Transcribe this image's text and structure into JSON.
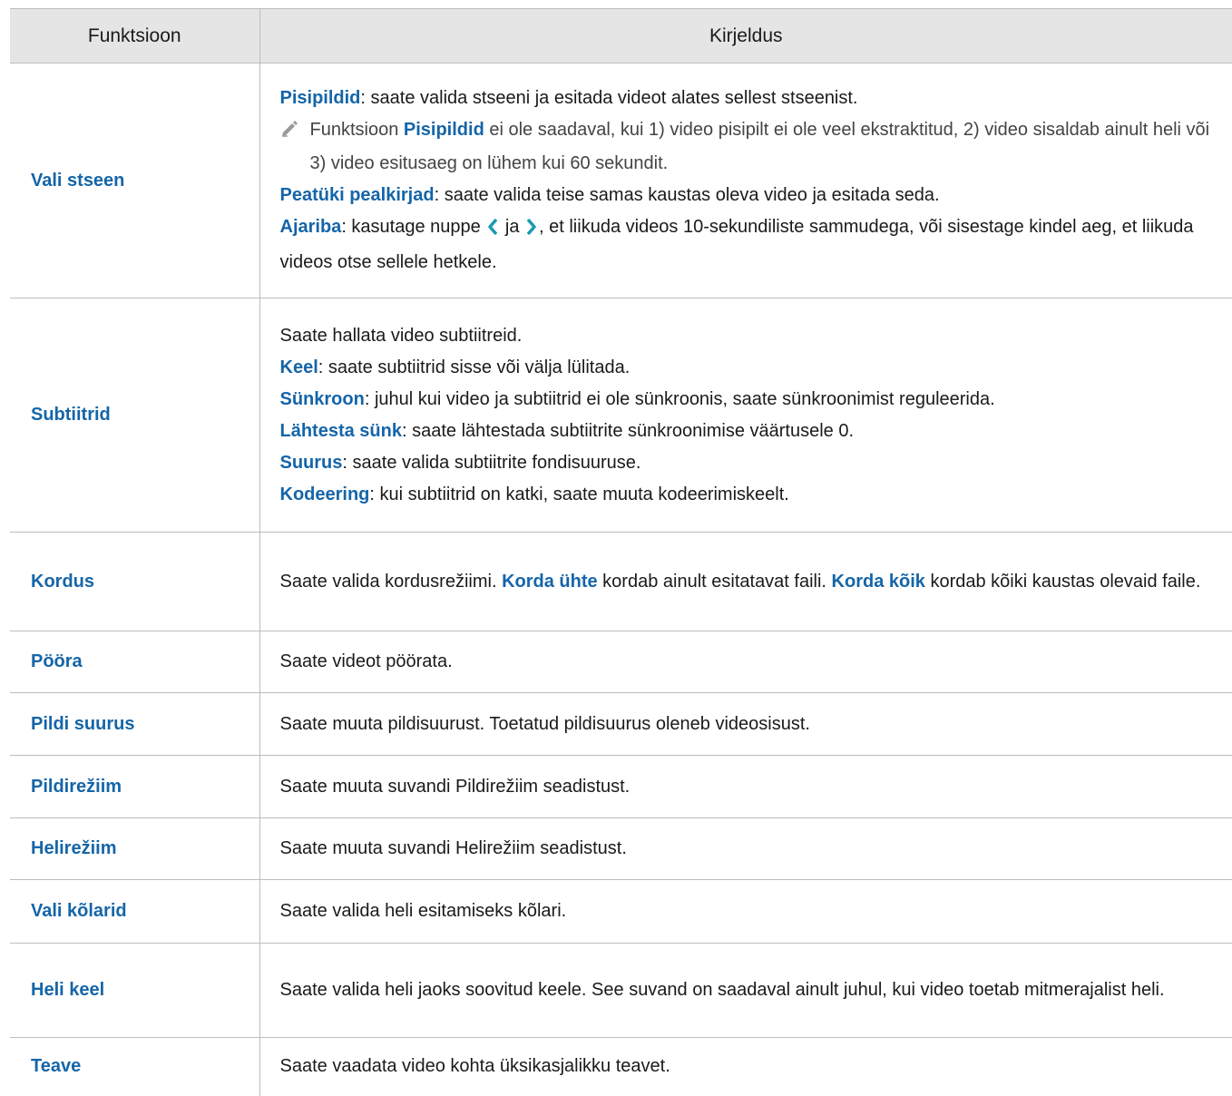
{
  "header": {
    "col1": "Funktsioon",
    "col2": "Kirjeldus"
  },
  "rows": [
    {
      "name": "Vali stseen",
      "l1_kw": "Pisipildid",
      "l1_text": ": saate valida stseeni ja esitada videot alates sellest stseenist.",
      "note_pre": "Funktsioon ",
      "note_kw": "Pisipildid",
      "note_text": " ei ole saadaval, kui 1) video pisipilt ei ole veel ekstraktitud, 2) video sisaldab ainult heli või 3) video esitusaeg on lühem kui 60 sekundit.",
      "l2_kw": "Peatüki pealkirjad",
      "l2_text": ": saate valida teise samas kaustas oleva video ja esitada seda.",
      "l3_kw": "Ajariba",
      "l3_text_a": ": kasutage nuppe ",
      "l3_text_b": " ja ",
      "l3_text_c": ", et liikuda videos 10-sekundiliste sammudega, või sisestage kindel aeg, et liikuda videos otse sellele hetkele."
    },
    {
      "name": "Subtiitrid",
      "intro": "Saate hallata video subtiitreid.",
      "items": [
        {
          "kw": "Keel",
          "text": ": saate subtiitrid sisse või välja lülitada."
        },
        {
          "kw": "Sünkroon",
          "text": ": juhul kui video ja subtiitrid ei ole sünkroonis, saate sünkroonimist reguleerida."
        },
        {
          "kw": "Lähtesta sünk",
          "text": ": saate lähtestada subtiitrite sünkroonimise väärtusele 0."
        },
        {
          "kw": "Suurus",
          "text": ": saate valida subtiitrite fondisuuruse."
        },
        {
          "kw": "Kodeering",
          "text": ": kui subtiitrid on katki, saate muuta kodeerimiskeelt."
        }
      ]
    },
    {
      "name": "Kordus",
      "t1": "Saate valida kordusrežiimi. ",
      "kw1": "Korda ühte",
      "t2": " kordab ainult esitatavat faili. ",
      "kw2": "Korda kõik",
      "t3": " kordab kõiki kaustas olevaid faile."
    },
    {
      "name": "Pööra",
      "desc": "Saate videot pöörata."
    },
    {
      "name": "Pildi suurus",
      "desc": "Saate muuta pildisuurust. Toetatud pildisuurus oleneb videosisust."
    },
    {
      "name": "Pildirežiim",
      "desc": "Saate muuta suvandi Pildirežiim seadistust."
    },
    {
      "name": "Helirežiim",
      "desc": "Saate muuta suvandi Helirežiim seadistust."
    },
    {
      "name": "Vali kõlarid",
      "desc": "Saate valida heli esitamiseks kõlari."
    },
    {
      "name": "Heli keel",
      "desc": "Saate valida heli jaoks soovitud keele. See suvand on saadaval ainult juhul, kui video toetab mitmerajalist heli."
    },
    {
      "name": "Teave",
      "desc": "Saate vaadata video kohta üksikasjalikku teavet."
    }
  ],
  "icons": {
    "note": "pencil-icon",
    "left": "chevron-left-icon",
    "right": "chevron-right-icon"
  },
  "colors": {
    "accent": "#1565a8",
    "header_bg": "#e5e5e5",
    "border": "#bdbdbd"
  }
}
